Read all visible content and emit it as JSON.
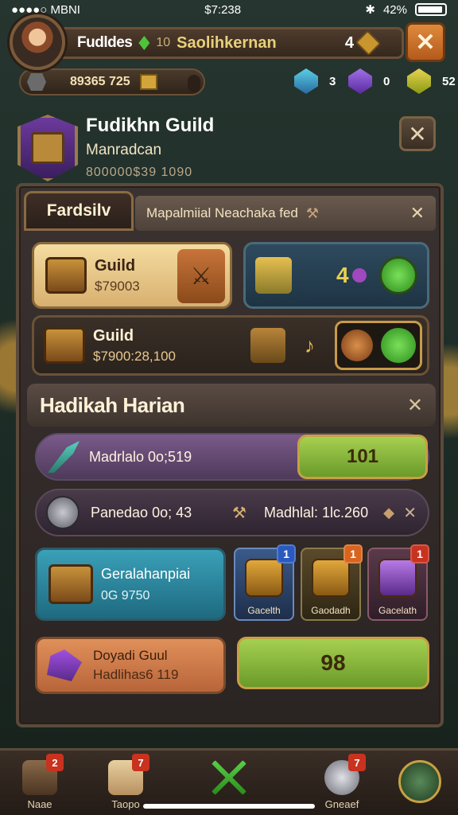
{
  "status": {
    "carrier": "●●●●○ MBNI",
    "time": "$7:238",
    "battery": "42%"
  },
  "header": {
    "player_name": "Fudldes",
    "level": "10",
    "server": "Saolihkernan",
    "count": "4"
  },
  "resources": {
    "main_amount": "89365 725",
    "gem_blue": "3",
    "gem_purple": "0",
    "gem_yellow": "52"
  },
  "guild": {
    "name": "Fudikhn Guild",
    "subtitle": "Manradcan",
    "id": "800000$39 1090"
  },
  "tabs": {
    "active": "Fardsilv",
    "strip_text": "Mapalmiial Neachaka fed"
  },
  "cards": {
    "guild1": {
      "label": "Guild",
      "value": "$79003"
    },
    "reward_count": "4",
    "guild2": {
      "label": "Guild",
      "value": "$7900:28,100"
    }
  },
  "daily": {
    "title": "Hadikah Harian",
    "mission1": {
      "label": "Madrlalo 0o;519",
      "value": "101"
    },
    "mission2": {
      "label": "Panedao 0o; 43",
      "right": "Madhlal: 1lc.260"
    }
  },
  "shop": {
    "main": {
      "title": "Geralahanpiai",
      "value": "0G 9750"
    },
    "items": [
      {
        "label": "Gacelth",
        "badge": "1"
      },
      {
        "label": "Gaodadh",
        "badge": "1"
      },
      {
        "label": "Gacelath",
        "badge": "1"
      }
    ]
  },
  "donate": {
    "title": "Doyadi Guul",
    "sub": "Hadlihas6 119",
    "button": "98"
  },
  "nav": [
    {
      "label": "Naae",
      "badge": "2"
    },
    {
      "label": "Taopo",
      "badge": "7"
    },
    {
      "label": "",
      "badge": ""
    },
    {
      "label": "Gneaef",
      "badge": "7"
    },
    {
      "label": "",
      "badge": ""
    }
  ],
  "colors": {
    "accent_orange": "#e08a3c",
    "green_button": "#7abf3a",
    "purple": "#6c3a9c",
    "teal": "#2e8aa0"
  }
}
